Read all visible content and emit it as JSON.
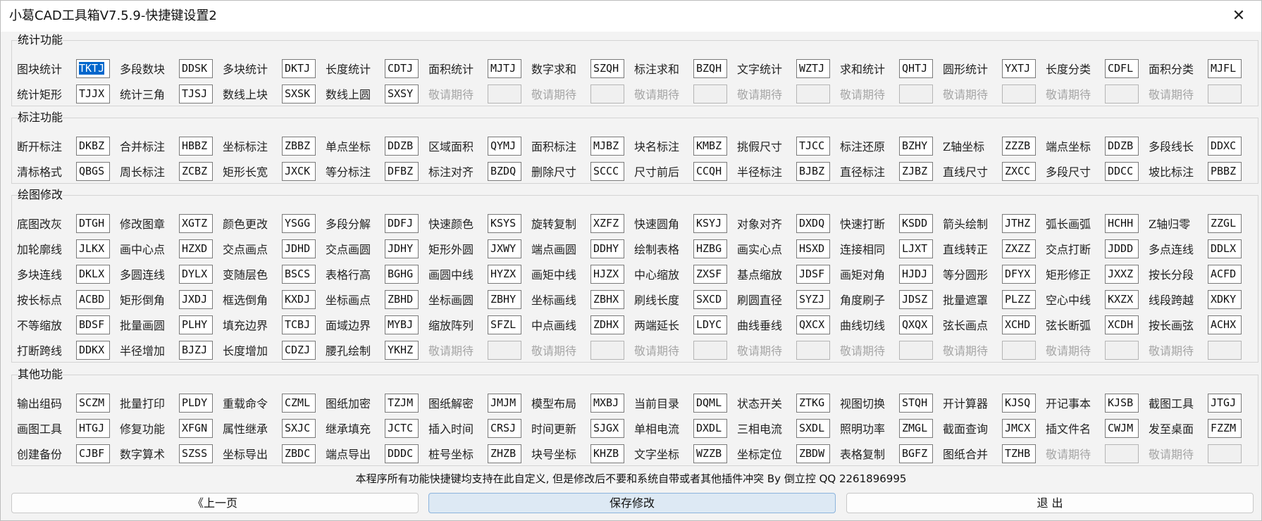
{
  "window": {
    "title": "小葛CAD工具箱V7.5.9-快捷键设置2",
    "close_label": "✕"
  },
  "sections": [
    {
      "title": "统计功能",
      "rows": [
        [
          [
            "图块统计",
            "TKTJ"
          ],
          [
            "多段数块",
            "DDSK"
          ],
          [
            "多块统计",
            "DKTJ"
          ],
          [
            "长度统计",
            "CDTJ"
          ],
          [
            "面积统计",
            "MJTJ"
          ],
          [
            "数字求和",
            "SZQH"
          ],
          [
            "标注求和",
            "BZQH"
          ],
          [
            "文字统计",
            "WZTJ"
          ],
          [
            "求和统计",
            "QHTJ"
          ],
          [
            "圆形统计",
            "YXTJ"
          ],
          [
            "长度分类",
            "CDFL"
          ],
          [
            "面积分类",
            "MJFL"
          ]
        ],
        [
          [
            "统计矩形",
            "TJJX"
          ],
          [
            "统计三角",
            "TJSJ"
          ],
          [
            "数线上块",
            "SXSK"
          ],
          [
            "数线上圆",
            "SXSY"
          ],
          [
            "敬请期待",
            ""
          ],
          [
            "敬请期待",
            ""
          ],
          [
            "敬请期待",
            ""
          ],
          [
            "敬请期待",
            ""
          ],
          [
            "敬请期待",
            ""
          ],
          [
            "敬请期待",
            ""
          ],
          [
            "敬请期待",
            ""
          ],
          [
            "敬请期待",
            ""
          ]
        ]
      ]
    },
    {
      "title": "标注功能",
      "rows": [
        [
          [
            "断开标注",
            "DKBZ"
          ],
          [
            "合并标注",
            "HBBZ"
          ],
          [
            "坐标标注",
            "ZBBZ"
          ],
          [
            "单点坐标",
            "DDZB"
          ],
          [
            "区域面积",
            "QYMJ"
          ],
          [
            "面积标注",
            "MJBZ"
          ],
          [
            "块名标注",
            "KMBZ"
          ],
          [
            "挑假尺寸",
            "TJCC"
          ],
          [
            "标注还原",
            "BZHY"
          ],
          [
            "Z轴坐标",
            "ZZZB"
          ],
          [
            "端点坐标",
            "DDZB"
          ],
          [
            "多段线长",
            "DDXC"
          ]
        ],
        [
          [
            "清标格式",
            "QBGS"
          ],
          [
            "周长标注",
            "ZCBZ"
          ],
          [
            "矩形长宽",
            "JXCK"
          ],
          [
            "等分标注",
            "DFBZ"
          ],
          [
            "标注对齐",
            "BZDQ"
          ],
          [
            "删除尺寸",
            "SCCC"
          ],
          [
            "尺寸前后",
            "CCQH"
          ],
          [
            "半径标注",
            "BJBZ"
          ],
          [
            "直径标注",
            "ZJBZ"
          ],
          [
            "直线尺寸",
            "ZXCC"
          ],
          [
            "多段尺寸",
            "DDCC"
          ],
          [
            "坡比标注",
            "PBBZ"
          ]
        ]
      ]
    },
    {
      "title": "绘图修改",
      "rows": [
        [
          [
            "底图改灰",
            "DTGH"
          ],
          [
            "修改图章",
            "XGTZ"
          ],
          [
            "颜色更改",
            "YSGG"
          ],
          [
            "多段分解",
            "DDFJ"
          ],
          [
            "快速颜色",
            "KSYS"
          ],
          [
            "旋转复制",
            "XZFZ"
          ],
          [
            "快速圆角",
            "KSYJ"
          ],
          [
            "对象对齐",
            "DXDQ"
          ],
          [
            "快速打断",
            "KSDD"
          ],
          [
            "箭头绘制",
            "JTHZ"
          ],
          [
            "弧长画弧",
            "HCHH"
          ],
          [
            "Z轴归零",
            "ZZGL"
          ]
        ],
        [
          [
            "加轮廓线",
            "JLKX"
          ],
          [
            "画中心点",
            "HZXD"
          ],
          [
            "交点画点",
            "JDHD"
          ],
          [
            "交点画圆",
            "JDHY"
          ],
          [
            "矩形外圆",
            "JXWY"
          ],
          [
            "端点画圆",
            "DDHY"
          ],
          [
            "绘制表格",
            "HZBG"
          ],
          [
            "画实心点",
            "HSXD"
          ],
          [
            "连接相同",
            "LJXT"
          ],
          [
            "直线转正",
            "ZXZZ"
          ],
          [
            "交点打断",
            "JDDD"
          ],
          [
            "多点连线",
            "DDLX"
          ]
        ],
        [
          [
            "多块连线",
            "DKLX"
          ],
          [
            "多圆连线",
            "DYLX"
          ],
          [
            "变随层色",
            "BSCS"
          ],
          [
            "表格行高",
            "BGHG"
          ],
          [
            "画圆中线",
            "HYZX"
          ],
          [
            "画矩中线",
            "HJZX"
          ],
          [
            "中心缩放",
            "ZXSF"
          ],
          [
            "基点缩放",
            "JDSF"
          ],
          [
            "画矩对角",
            "HJDJ"
          ],
          [
            "等分圆形",
            "DFYX"
          ],
          [
            "矩形修正",
            "JXXZ"
          ],
          [
            "按长分段",
            "ACFD"
          ]
        ],
        [
          [
            "按长标点",
            "ACBD"
          ],
          [
            "矩形倒角",
            "JXDJ"
          ],
          [
            "框选倒角",
            "KXDJ"
          ],
          [
            "坐标画点",
            "ZBHD"
          ],
          [
            "坐标画圆",
            "ZBHY"
          ],
          [
            "坐标画线",
            "ZBHX"
          ],
          [
            "刷线长度",
            "SXCD"
          ],
          [
            "刷圆直径",
            "SYZJ"
          ],
          [
            "角度刷子",
            "JDSZ"
          ],
          [
            "批量遮罩",
            "PLZZ"
          ],
          [
            "空心中线",
            "KXZX"
          ],
          [
            "线段跨越",
            "XDKY"
          ]
        ],
        [
          [
            "不等缩放",
            "BDSF"
          ],
          [
            "批量画圆",
            "PLHY"
          ],
          [
            "填充边界",
            "TCBJ"
          ],
          [
            "面域边界",
            "MYBJ"
          ],
          [
            "缩放阵列",
            "SFZL"
          ],
          [
            "中点画线",
            "ZDHX"
          ],
          [
            "两端延长",
            "LDYC"
          ],
          [
            "曲线垂线",
            "QXCX"
          ],
          [
            "曲线切线",
            "QXQX"
          ],
          [
            "弦长画点",
            "XCHD"
          ],
          [
            "弦长断弧",
            "XCDH"
          ],
          [
            "按长画弦",
            "ACHX"
          ]
        ],
        [
          [
            "打断跨线",
            "DDKX"
          ],
          [
            "半径增加",
            "BJZJ"
          ],
          [
            "长度增加",
            "CDZJ"
          ],
          [
            "腰孔绘制",
            "YKHZ"
          ],
          [
            "敬请期待",
            ""
          ],
          [
            "敬请期待",
            ""
          ],
          [
            "敬请期待",
            ""
          ],
          [
            "敬请期待",
            ""
          ],
          [
            "敬请期待",
            ""
          ],
          [
            "敬请期待",
            ""
          ],
          [
            "敬请期待",
            ""
          ],
          [
            "敬请期待",
            ""
          ]
        ]
      ]
    },
    {
      "title": "其他功能",
      "rows": [
        [
          [
            "输出组码",
            "SCZM"
          ],
          [
            "批量打印",
            "PLDY"
          ],
          [
            "重载命令",
            "CZML"
          ],
          [
            "图纸加密",
            "TZJM"
          ],
          [
            "图纸解密",
            "JMJM"
          ],
          [
            "模型布局",
            "MXBJ"
          ],
          [
            "当前目录",
            "DQML"
          ],
          [
            "状态开关",
            "ZTKG"
          ],
          [
            "视图切换",
            "STQH"
          ],
          [
            "开计算器",
            "KJSQ"
          ],
          [
            "开记事本",
            "KJSB"
          ],
          [
            "截图工具",
            "JTGJ"
          ]
        ],
        [
          [
            "画图工具",
            "HTGJ"
          ],
          [
            "修复功能",
            "XFGN"
          ],
          [
            "属性继承",
            "SXJC"
          ],
          [
            "继承填充",
            "JCTC"
          ],
          [
            "插入时间",
            "CRSJ"
          ],
          [
            "时间更新",
            "SJGX"
          ],
          [
            "单相电流",
            "DXDL"
          ],
          [
            "三相电流",
            "SXDL"
          ],
          [
            "照明功率",
            "ZMGL"
          ],
          [
            "截面查询",
            "JMCX"
          ],
          [
            "插文件名",
            "CWJM"
          ],
          [
            "发至桌面",
            "FZZM"
          ]
        ],
        [
          [
            "创建备份",
            "CJBF"
          ],
          [
            "数字算术",
            "SZSS"
          ],
          [
            "坐标导出",
            "ZBDC"
          ],
          [
            "端点导出",
            "DDDC"
          ],
          [
            "桩号坐标",
            "ZHZB"
          ],
          [
            "块号坐标",
            "KHZB"
          ],
          [
            "文字坐标",
            "WZZB"
          ],
          [
            "坐标定位",
            "ZBDW"
          ],
          [
            "表格复制",
            "BGFZ"
          ],
          [
            "图纸合并",
            "TZHB"
          ],
          [
            "敬请期待",
            ""
          ],
          [
            "敬请期待",
            ""
          ]
        ]
      ]
    }
  ],
  "footer": {
    "note": "本程序所有功能快捷键均支持在此自定义, 但是修改后不要和系统自带或者其他插件冲突  By 倒立控 QQ 2261896995",
    "prev_label": "《上一页",
    "save_label": "保存修改",
    "exit_label": "退  出"
  },
  "disabled_label": "敬请期待",
  "selected_field": "TKTJ",
  "colors": {
    "accent": "#0066cc",
    "primary_button": "#dde9f4",
    "disabled_text": "#a6a6a6"
  }
}
